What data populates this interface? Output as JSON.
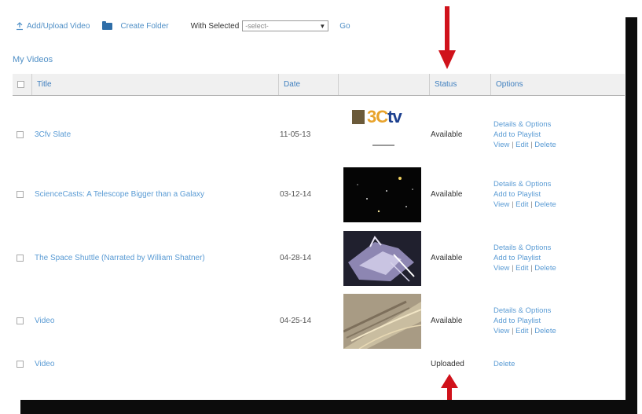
{
  "toolbar": {
    "upload_label": "Add/Upload Video",
    "folder_label": "Create Folder",
    "with_selected_label": "With Selected",
    "select_value": "-select-",
    "go_label": "Go"
  },
  "section_title": "My Videos",
  "columns": {
    "title": "Title",
    "date": "Date",
    "status": "Status",
    "options": "Options"
  },
  "videos": [
    {
      "title": "3Cfv Slate",
      "date": "11-05-13",
      "status": "Available",
      "thumb_logo": "3Ctv"
    },
    {
      "title": "ScienceCasts: A Telescope Bigger than a Galaxy",
      "date": "03-12-14",
      "status": "Available"
    },
    {
      "title": "The Space Shuttle (Narrated by William Shatner)",
      "date": "04-28-14",
      "status": "Available"
    },
    {
      "title": "Video",
      "date": "04-25-14",
      "status": "Available"
    },
    {
      "title": "Video",
      "date": "",
      "status": "Uploaded"
    }
  ],
  "options": {
    "details": "Details & Options",
    "playlist": "Add to Playlist",
    "view": "View",
    "edit": "Edit",
    "delete": "Delete",
    "separator": "|"
  },
  "colors": {
    "link": "#5a9bd4",
    "arrow": "#d0121b",
    "border": "#0c0c0c"
  },
  "icons": [
    "upload-icon",
    "folder-icon",
    "chevron-down-icon",
    "arrow-down-icon",
    "arrow-up-icon"
  ]
}
